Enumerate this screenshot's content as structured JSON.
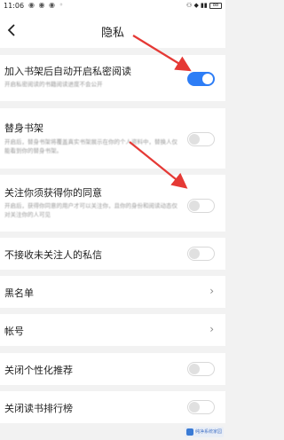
{
  "status_bar": {
    "time": "11:06",
    "left_dots": "◉ ◉ ◉ ◦",
    "right_info": "⚇ ◆ ▮▮ ",
    "battery": "88"
  },
  "nav": {
    "title": "隐私"
  },
  "settings": [
    {
      "title": "加入书架后自动开启私密阅读",
      "desc": "开启私密阅读的书籍阅读进度不会公开",
      "control": "toggle",
      "on": true
    },
    {
      "title": "替身书架",
      "desc": "开启后，替身书架将覆盖真实书架展示在你的个人资料中，替换人仅能看到你的替身书架。",
      "control": "toggle",
      "on": false
    },
    {
      "title": "关注你须获得你的同意",
      "desc": "开启后，获得你同意的用户才可以关注你，且你的身份和阅读动态仅对关注你的人可见",
      "control": "toggle",
      "on": false
    },
    {
      "title": "不接收未关注人的私信",
      "control": "toggle",
      "on": false
    },
    {
      "title": "黑名单",
      "control": "chevron"
    },
    {
      "title": "帐号",
      "control": "chevron"
    },
    {
      "title": "关闭个性化推荐",
      "control": "toggle",
      "on": false
    },
    {
      "title": "关闭读书排行榜",
      "control": "toggle",
      "on": false
    }
  ],
  "icons": {
    "back": "chevron-left-icon",
    "chevron": "›"
  },
  "colors": {
    "accent": "#2d7df6",
    "arrow": "#e53935"
  },
  "watermark": "纯净系统家园"
}
